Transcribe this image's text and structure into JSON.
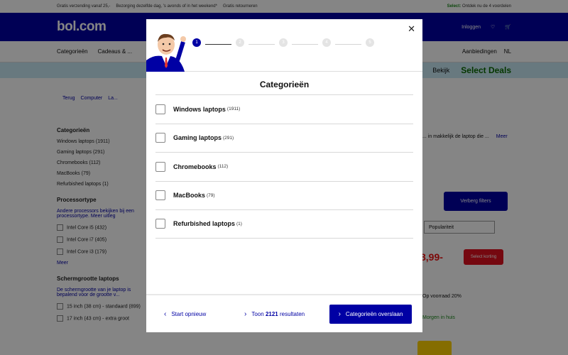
{
  "topbar": {
    "left": "Gratis verzending vanaf 25,-",
    "mid1": "Bezorging dezelfde dag, 's avonds of in het weekend*",
    "mid2": "Gratis retourneren",
    "right_green": "Select:",
    "right": "Ontdek nu de 4 voordelen"
  },
  "header": {
    "logo": "bol.com",
    "account": "Inloggen"
  },
  "nav": {
    "categories": "Categorieën",
    "gifts": "Cadeaus & ...",
    "deals": "Aanbiedingen",
    "lang": "NL"
  },
  "promo": {
    "text": "Select Deals",
    "prefix": "Bekijk"
  },
  "breadcrumb": {
    "back": "Terug",
    "a": "Computer",
    "b": "La..."
  },
  "sidebar": {
    "cat_title": "Categorieën",
    "cats": [
      "Windows laptops (1911)",
      "Gaming laptops (291)",
      "Chromebooks (112)",
      "MacBooks (79)",
      "Refurbished laptops (1)"
    ],
    "proc_title": "Processortype",
    "proc_hint": "Andere processors bekijken bij een processortype. Meer uitleg",
    "procs": [
      "Intel Core i5 (432)",
      "Intel Core i7 (405)",
      "Intel Core i3 (179)"
    ],
    "more": "Meer",
    "screen_title": "Schermgrootte laptops",
    "screen_hint": "De schermgrootte van je laptop is bepalend voor de grootte v...",
    "screens": [
      "15 inch (38 cm) - standaard (899)",
      "17 inch (43 cm) - extra groot"
    ]
  },
  "right": {
    "desc": "... in makkelijk de laptop die ...",
    "desc_more": "Meer",
    "hide_button": "Verberg filters",
    "sort": "Populariteit",
    "price": "8,99-",
    "price_badge": "Select korting",
    "stock": "Op voorraad 20%",
    "delivery": "Morgen in huis"
  },
  "modal": {
    "steps": [
      "1",
      "2",
      "3",
      "4",
      "5"
    ],
    "title": "Categorieën",
    "options": [
      {
        "name": "Windows laptops",
        "count": "(1911)"
      },
      {
        "name": "Gaming laptops",
        "count": "(291)"
      },
      {
        "name": "Chromebooks",
        "count": "(112)"
      },
      {
        "name": "MacBooks",
        "count": "(79)"
      },
      {
        "name": "Refurbished laptops",
        "count": "(1)"
      }
    ],
    "footer": {
      "reset": "Start opnieuw",
      "show_prefix": "Toon",
      "show_count": "2121",
      "show_suffix": "resultaten",
      "skip": "Categorieën overslaan"
    }
  },
  "colors": {
    "brand": "#0000a4",
    "promo_bg": "#c8e8f4",
    "deal": "#0a6a00"
  }
}
